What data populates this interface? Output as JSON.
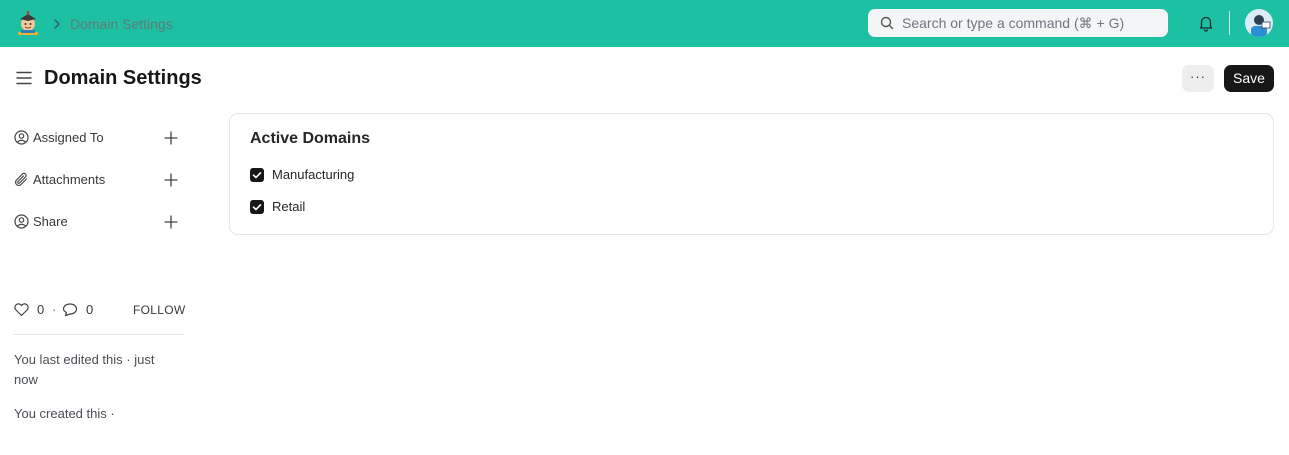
{
  "navbar": {
    "breadcrumb": "Domain Settings",
    "search_placeholder": "Search or type a command (⌘ + G)",
    "icons": {
      "logo": "app-logo",
      "chevron": "chevron-right-icon",
      "search": "search-icon",
      "bell": "bell-icon",
      "avatar": "user-avatar"
    },
    "color": "#1ec0a3"
  },
  "header": {
    "title": "Domain Settings",
    "more_label": "···",
    "save_label": "Save"
  },
  "sidebar": {
    "items": [
      {
        "label": "Assigned To",
        "icon": "user-assign-icon"
      },
      {
        "label": "Attachments",
        "icon": "paperclip-icon"
      },
      {
        "label": "Share",
        "icon": "share-user-icon"
      }
    ],
    "likes": "0",
    "separator": "·",
    "comments": "0",
    "follow_label": "FOLLOW",
    "activity": [
      "You last edited this · just now",
      "You created this ·"
    ]
  },
  "card": {
    "title": "Active Domains",
    "options": [
      {
        "label": "Manufacturing",
        "checked": true
      },
      {
        "label": "Retail",
        "checked": true
      }
    ]
  }
}
